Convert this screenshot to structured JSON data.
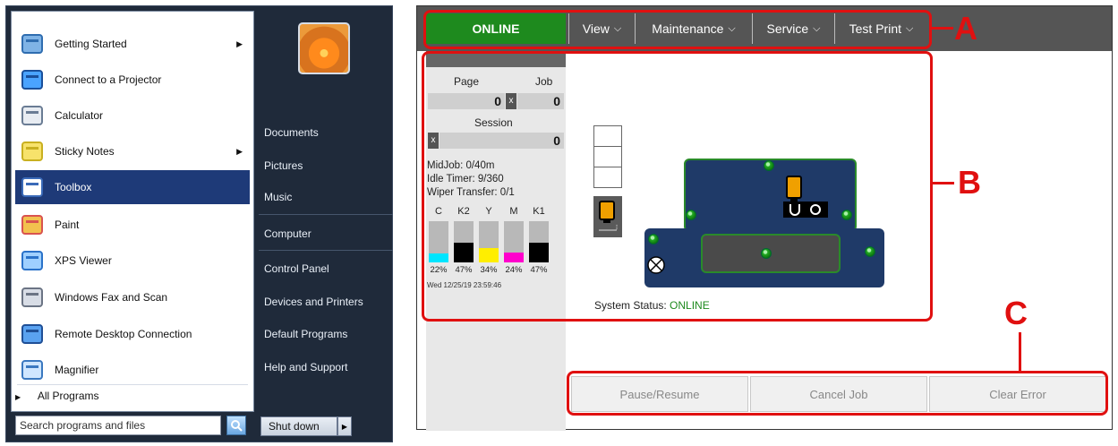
{
  "start_menu": {
    "programs": [
      {
        "label": "Getting Started",
        "icon": "getting-started-icon",
        "has_submenu": true
      },
      {
        "label": "Connect to a Projector",
        "icon": "projector-icon",
        "has_submenu": false
      },
      {
        "label": "Calculator",
        "icon": "calculator-icon",
        "has_submenu": false
      },
      {
        "label": "Sticky Notes",
        "icon": "sticky-notes-icon",
        "has_submenu": true
      },
      {
        "label": "Toolbox",
        "icon": "toolbox-icon",
        "has_submenu": false,
        "selected": true
      },
      {
        "label": "Paint",
        "icon": "paint-icon",
        "has_submenu": false
      },
      {
        "label": "XPS Viewer",
        "icon": "xps-viewer-icon",
        "has_submenu": false
      },
      {
        "label": "Windows Fax and Scan",
        "icon": "fax-scan-icon",
        "has_submenu": false
      },
      {
        "label": "Remote Desktop Connection",
        "icon": "remote-desktop-icon",
        "has_submenu": false
      },
      {
        "label": "Magnifier",
        "icon": "magnifier-icon",
        "has_submenu": false
      }
    ],
    "all_programs": "All Programs",
    "search_placeholder": "Search programs and files",
    "right_links": [
      "Documents",
      "Pictures",
      "Music",
      "Computer",
      "Control Panel",
      "Devices and Printers",
      "Default Programs",
      "Help and Support"
    ],
    "shutdown_label": "Shut down"
  },
  "printer_ui": {
    "status_tab": "ONLINE",
    "menu": [
      "View",
      "Maintenance",
      "Service",
      "Test Print"
    ],
    "counters": {
      "page_label": "Page",
      "job_label": "Job",
      "page_value": "0",
      "job_value": "0",
      "session_label": "Session",
      "session_value": "0",
      "x_label": "x"
    },
    "info": [
      "MidJob: 0/40m",
      "Idle Timer: 9/360",
      "Wiper Transfer: 0/1"
    ],
    "inks": [
      {
        "name": "C",
        "percent": "22%",
        "level": 0.22,
        "color": "#00e5ff"
      },
      {
        "name": "K2",
        "percent": "47%",
        "level": 0.47,
        "color": "#000000"
      },
      {
        "name": "Y",
        "percent": "34%",
        "level": 0.34,
        "color": "#ffee00"
      },
      {
        "name": "M",
        "percent": "24%",
        "level": 0.24,
        "color": "#ff00cc"
      },
      {
        "name": "K1",
        "percent": "47%",
        "level": 0.47,
        "color": "#000000"
      }
    ],
    "datetime": "Wed 12/25/19 23:59:46",
    "system_status_label": "System Status:",
    "system_status_value": "ONLINE",
    "buttons": [
      "Pause/Resume",
      "Cancel Job",
      "Clear Error"
    ]
  },
  "callouts": [
    "A",
    "B",
    "C"
  ]
}
